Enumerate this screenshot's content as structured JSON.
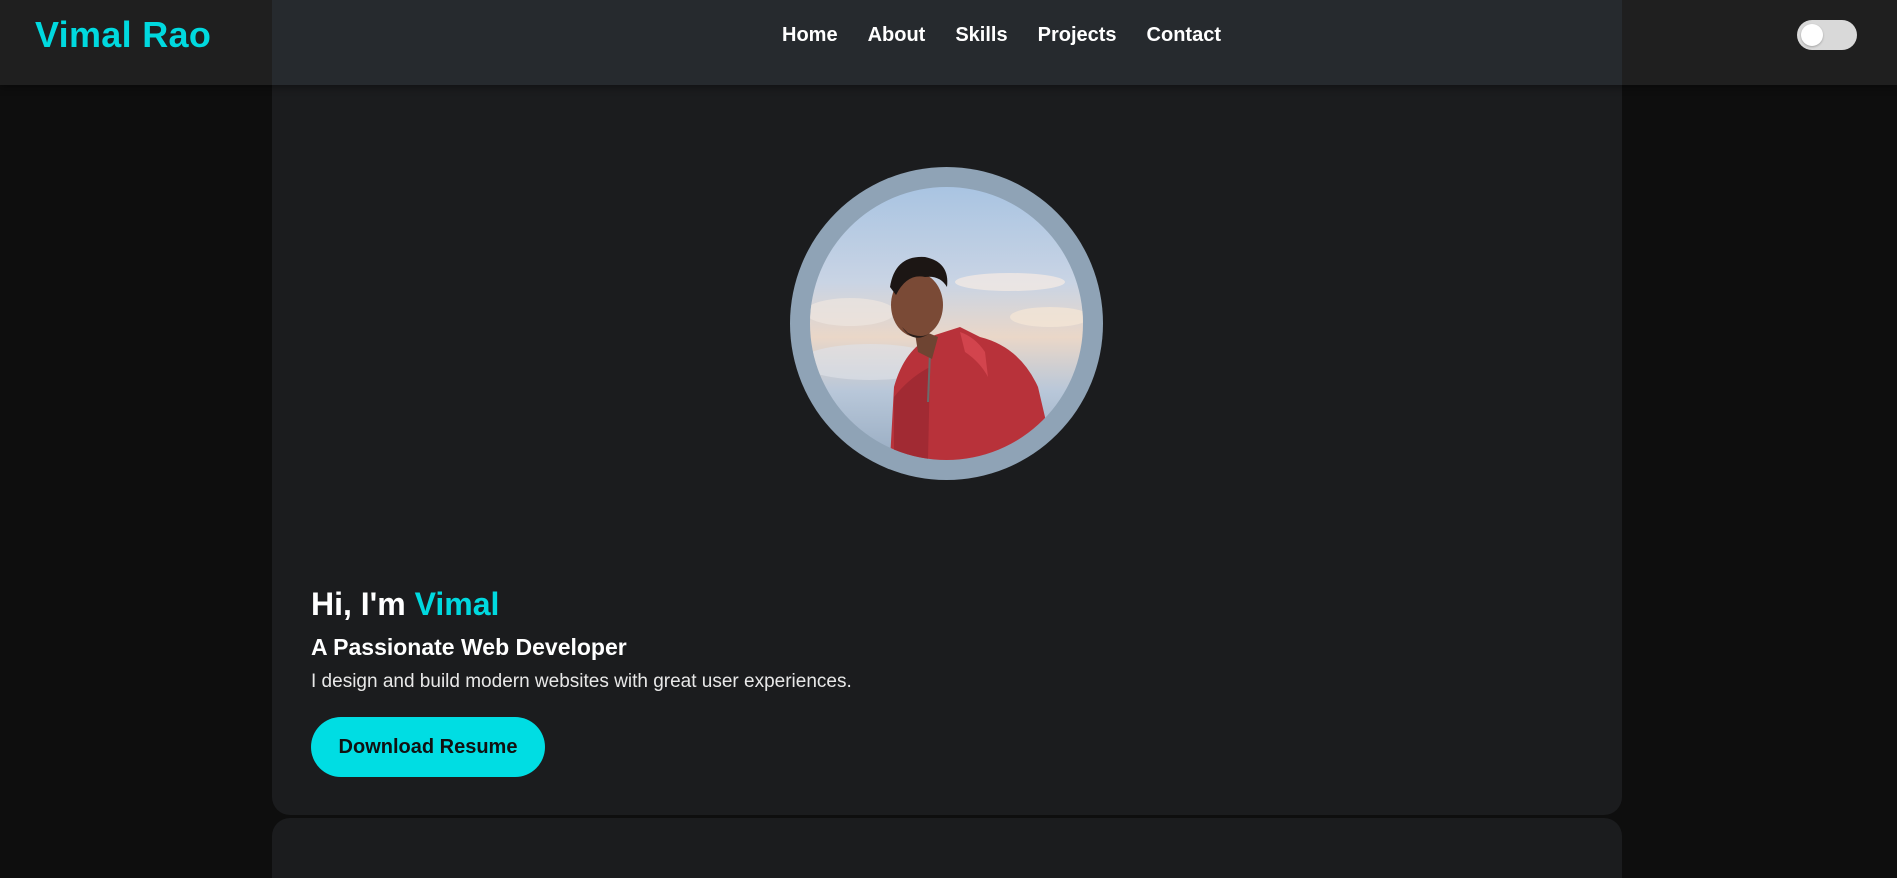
{
  "header": {
    "brand": "Vimal Rao",
    "nav": [
      {
        "label": "Home"
      },
      {
        "label": "About"
      },
      {
        "label": "Skills"
      },
      {
        "label": "Projects"
      },
      {
        "label": "Contact"
      }
    ],
    "theme_toggle": {
      "state": "off",
      "icon": "toggle-switch"
    }
  },
  "hero": {
    "greeting_prefix": "Hi, I'm ",
    "greeting_name": "Vimal",
    "subtitle": "A Passionate Web Developer",
    "description": "I design and build modern websites with great user experiences.",
    "cta_label": "Download Resume",
    "avatar_icon": "profile-photo"
  },
  "colors": {
    "accent": "#00d9df",
    "background": "#0e0e0e",
    "card": "#1b1c1e",
    "header": "#262a2e"
  }
}
